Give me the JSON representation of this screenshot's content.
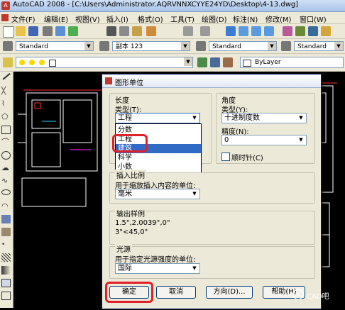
{
  "window": {
    "title": "AutoCAD 2008 - [C:\\Users\\Administrator.AQRVNNXCYYE24YD\\Desktop\\4-13.dwg]"
  },
  "menu": [
    "文件(F)",
    "编辑(E)",
    "视图(V)",
    "插入(I)",
    "格式(O)",
    "工具(T)",
    "绘图(D)",
    "标注(N)",
    "修改(M)",
    "窗口(W)"
  ],
  "toolbar": {
    "style1": "Standard",
    "style2": "副本 123",
    "style3": "Standard",
    "style4": "Standard",
    "layer_color": "ByLayer"
  },
  "dialog": {
    "title": "图形单位",
    "length": {
      "group_label": "长度",
      "type_label": "类型(T):",
      "type_value": "工程",
      "options": [
        "分数",
        "工程",
        "建筑",
        "科学",
        "小数"
      ],
      "highlighted_option": "建筑"
    },
    "angle": {
      "group_label": "角度",
      "type_label": "类型(Y):",
      "type_value": "十进制度数",
      "precision_label": "精度(N):",
      "precision_value": "0",
      "clockwise_label": "顺时针(C)"
    },
    "insert_scale": {
      "group_label": "插入比例",
      "desc": "用于缩放插入内容的单位:",
      "value": "毫米"
    },
    "sample": {
      "group_label": "输出样例",
      "line1": "1.5\",2.0039\",0\"",
      "line2": "3\"<45,0\""
    },
    "lighting": {
      "group_label": "光源",
      "desc": "用于指定光源强度的单位:",
      "value": "国际"
    },
    "buttons": {
      "ok": "确定",
      "cancel": "取消",
      "direction": "方向(D)...",
      "help": "帮助(H)"
    }
  },
  "watermark": "CAD吧",
  "colors": {
    "highlight": "#316ac5",
    "annotation": "#e0202a",
    "canvas_lines": "#ffffff"
  }
}
